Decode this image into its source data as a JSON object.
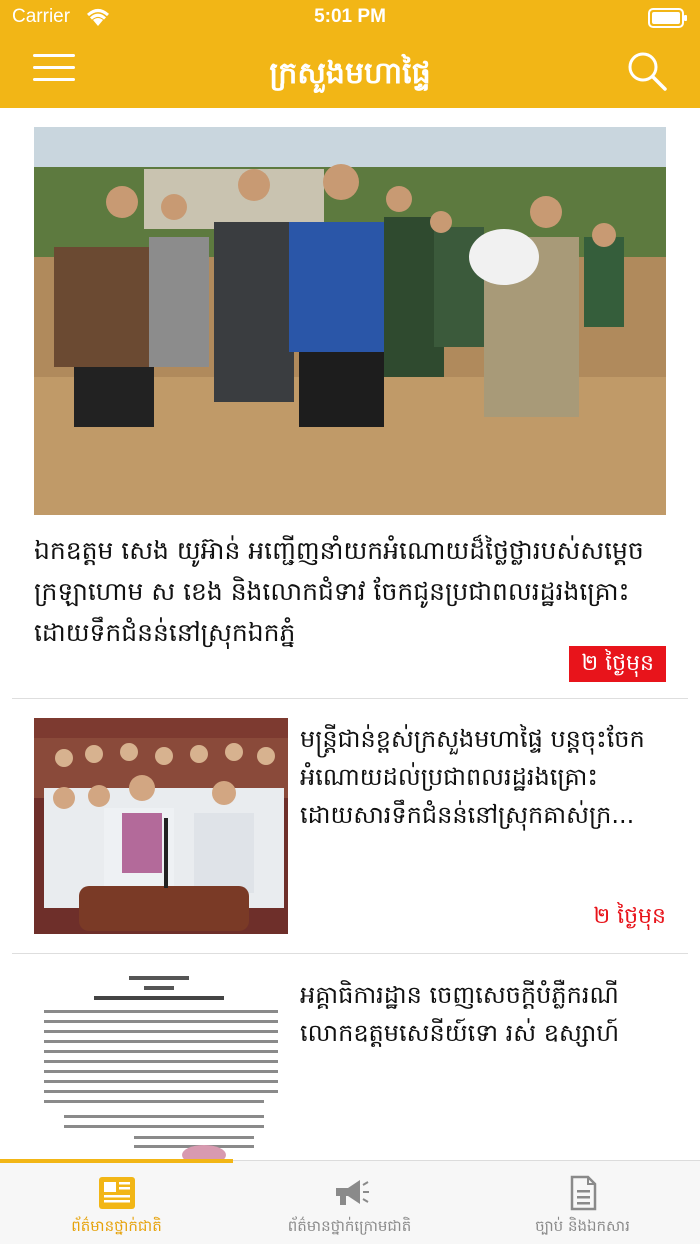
{
  "status_bar": {
    "carrier": "Carrier",
    "time": "5:01 PM"
  },
  "nav": {
    "title": "ក្រសួងមហាផ្ទៃ"
  },
  "hero": {
    "title": "ឯកឧត្តម សេង យូអ៊ាន់ អញ្ជើញនាំយកអំណោយដ៏ថ្លៃថ្លារបស់សម្តេចក្រឡាហោម ស ខេង និងលោកជំទាវ ចែកជូនប្រជាពលរដ្ឋរងគ្រោះដោយទឹកជំនន់នៅស្រុកឯកភ្នំ",
    "time": "២ ថ្ងៃមុន"
  },
  "articles": [
    {
      "title": "មន្ត្រីជាន់ខ្ពស់ក្រសួងមហាផ្ទៃ បន្តចុះចែកអំណោយដល់ប្រជាពលរដ្ឋរងគ្រោះដោយសារទឹកជំនន់នៅស្រុកគាស់ក្រ...",
      "time": "២ ថ្ងៃមុន"
    },
    {
      "title": "អគ្គាធិការដ្ឋាន ចេញសេចក្តីបំភ្លឺករណីលោកឧត្តមសេនីយ៍ទោ រស់ ឧស្សាហ៍",
      "time": ""
    }
  ],
  "tabs": [
    {
      "label": "ព័ត៌មានថ្នាក់ជាតិ",
      "icon": "newspaper-icon",
      "active": true
    },
    {
      "label": "ព័ត៌មានថ្នាក់ក្រោមជាតិ",
      "icon": "megaphone-icon",
      "active": false
    },
    {
      "label": "ច្បាប់ និងឯកសារ",
      "icon": "document-icon",
      "active": false
    }
  ],
  "colors": {
    "brand": "#f2b616",
    "accent_red": "#e8141b",
    "tab_active": "#e6a20a",
    "tab_inactive": "#8a8a8a"
  }
}
